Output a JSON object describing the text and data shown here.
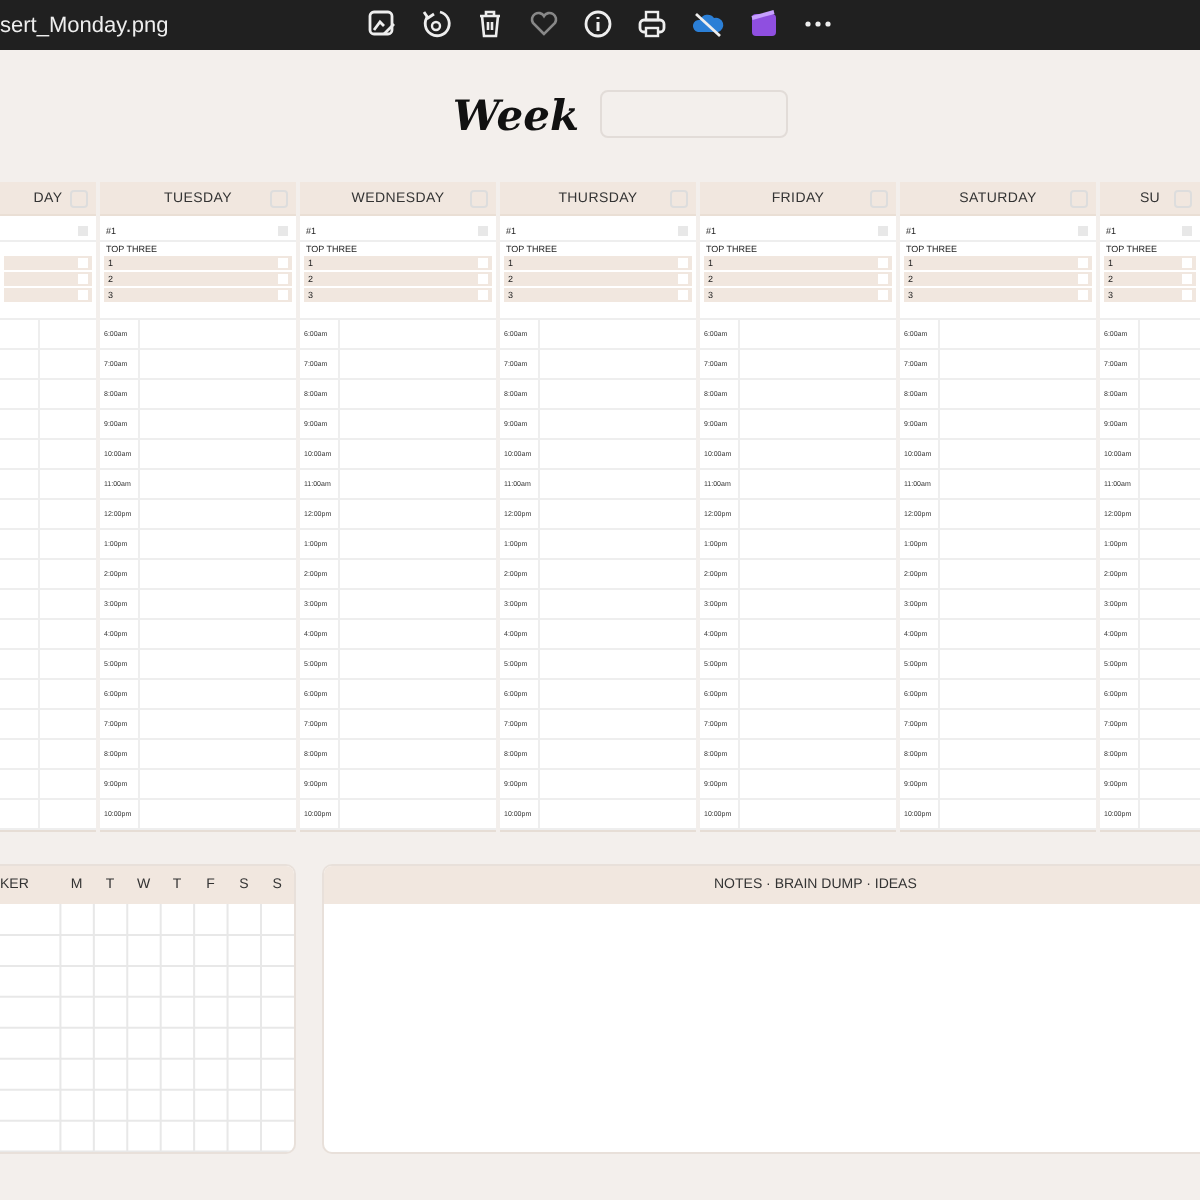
{
  "window": {
    "title": "sert_Monday.png"
  },
  "planner": {
    "title": "Week",
    "days": [
      {
        "name": "DAY",
        "checked": false,
        "first": {
          "checked": false
        },
        "tasks": [
          {
            "checked": false
          },
          {
            "checked": false
          },
          {
            "checked": false
          }
        ]
      },
      {
        "name": "TUESDAY",
        "checked": false,
        "first": {
          "label": "#1",
          "checked": false
        },
        "top_three_label": "TOP THREE",
        "tasks": [
          {
            "label": "1",
            "checked": false
          },
          {
            "label": "2",
            "checked": false
          },
          {
            "label": "3",
            "checked": false
          }
        ],
        "times": [
          "6:00am",
          "7:00am",
          "8:00am",
          "9:00am",
          "10:00am",
          "11:00am",
          "12:00pm",
          "1:00pm",
          "2:00pm",
          "3:00pm",
          "4:00pm",
          "5:00pm",
          "6:00pm",
          "7:00pm",
          "8:00pm",
          "9:00pm",
          "10:00pm"
        ]
      },
      {
        "name": "WEDNESDAY",
        "checked": false,
        "first": {
          "label": "#1",
          "checked": false
        },
        "top_three_label": "TOP THREE",
        "tasks": [
          {
            "label": "1",
            "checked": false
          },
          {
            "label": "2",
            "checked": false
          },
          {
            "label": "3",
            "checked": false
          }
        ],
        "times": [
          "6:00am",
          "7:00am",
          "8:00am",
          "9:00am",
          "10:00am",
          "11:00am",
          "12:00pm",
          "1:00pm",
          "2:00pm",
          "3:00pm",
          "4:00pm",
          "5:00pm",
          "6:00pm",
          "7:00pm",
          "8:00pm",
          "9:00pm",
          "10:00pm"
        ]
      },
      {
        "name": "THURSDAY",
        "checked": false,
        "first": {
          "label": "#1",
          "checked": false
        },
        "top_three_label": "TOP THREE",
        "tasks": [
          {
            "label": "1",
            "checked": false
          },
          {
            "label": "2",
            "checked": false
          },
          {
            "label": "3",
            "checked": false
          }
        ],
        "times": [
          "6:00am",
          "7:00am",
          "8:00am",
          "9:00am",
          "10:00am",
          "11:00am",
          "12:00pm",
          "1:00pm",
          "2:00pm",
          "3:00pm",
          "4:00pm",
          "5:00pm",
          "6:00pm",
          "7:00pm",
          "8:00pm",
          "9:00pm",
          "10:00pm"
        ]
      },
      {
        "name": "FRIDAY",
        "checked": false,
        "first": {
          "label": "#1",
          "checked": false
        },
        "top_three_label": "TOP THREE",
        "tasks": [
          {
            "label": "1",
            "checked": false
          },
          {
            "label": "2",
            "checked": false
          },
          {
            "label": "3",
            "checked": false
          }
        ],
        "times": [
          "6:00am",
          "7:00am",
          "8:00am",
          "9:00am",
          "10:00am",
          "11:00am",
          "12:00pm",
          "1:00pm",
          "2:00pm",
          "3:00pm",
          "4:00pm",
          "5:00pm",
          "6:00pm",
          "7:00pm",
          "8:00pm",
          "9:00pm",
          "10:00pm"
        ]
      },
      {
        "name": "SATURDAY",
        "checked": false,
        "first": {
          "label": "#1",
          "checked": false
        },
        "top_three_label": "TOP THREE",
        "tasks": [
          {
            "label": "1",
            "checked": false
          },
          {
            "label": "2",
            "checked": false
          },
          {
            "label": "3",
            "checked": false
          }
        ],
        "times": [
          "6:00am",
          "7:00am",
          "8:00am",
          "9:00am",
          "10:00am",
          "11:00am",
          "12:00pm",
          "1:00pm",
          "2:00pm",
          "3:00pm",
          "4:00pm",
          "5:00pm",
          "6:00pm",
          "7:00pm",
          "8:00pm",
          "9:00pm",
          "10:00pm"
        ]
      },
      {
        "name": "SU",
        "checked": false,
        "first": {
          "label": "#1",
          "checked": false
        },
        "top_three_label": "TOP THREE",
        "tasks": [
          {
            "label": "1",
            "checked": false
          },
          {
            "label": "2",
            "checked": false
          },
          {
            "label": "3",
            "checked": false
          }
        ],
        "times": [
          "6:00am",
          "7:00am",
          "8:00am",
          "9:00am",
          "10:00am",
          "11:00am",
          "12:00pm",
          "1:00pm",
          "2:00pm",
          "3:00pm",
          "4:00pm",
          "5:00pm",
          "6:00pm",
          "7:00pm",
          "8:00pm",
          "9:00pm",
          "10:00pm"
        ]
      }
    ],
    "tracker": {
      "title": "KER",
      "days": [
        "M",
        "T",
        "W",
        "T",
        "F",
        "S",
        "S"
      ]
    },
    "notes": {
      "title": "NOTES · BRAIN DUMP · IDEAS"
    }
  }
}
